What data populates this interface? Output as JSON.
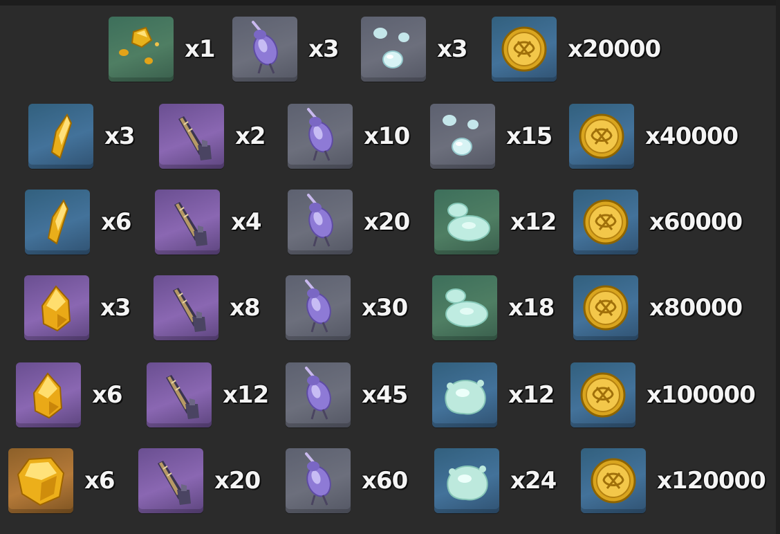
{
  "rows": [
    {
      "cells": [
        {
          "item": "gold-shards-icon",
          "rarity": "green",
          "qty": "x1"
        },
        {
          "item": "beetle-icon",
          "rarity": "gray",
          "qty": "x3"
        },
        {
          "item": "slime-drops-icon",
          "rarity": "gray",
          "qty": "x3"
        },
        {
          "item": "mora-coin-icon",
          "rarity": "blue",
          "qty": "x20000"
        }
      ]
    },
    {
      "cells": [
        {
          "item": "gold-sliver-icon",
          "rarity": "blue",
          "qty": "x3"
        },
        {
          "item": "drill-icon",
          "rarity": "purple",
          "qty": "x2"
        },
        {
          "item": "beetle-icon",
          "rarity": "gray",
          "qty": "x10"
        },
        {
          "item": "slime-drops-icon",
          "rarity": "gray",
          "qty": "x15"
        },
        {
          "item": "mora-coin-icon",
          "rarity": "blue",
          "qty": "x40000"
        }
      ]
    },
    {
      "cells": [
        {
          "item": "gold-sliver-icon",
          "rarity": "blue",
          "qty": "x6"
        },
        {
          "item": "drill-icon",
          "rarity": "purple",
          "qty": "x4"
        },
        {
          "item": "beetle-icon",
          "rarity": "gray",
          "qty": "x20"
        },
        {
          "item": "slime-puddle-icon",
          "rarity": "green",
          "qty": "x12"
        },
        {
          "item": "mora-coin-icon",
          "rarity": "blue",
          "qty": "x60000"
        }
      ]
    },
    {
      "cells": [
        {
          "item": "gold-chunk-icon",
          "rarity": "purple",
          "qty": "x3"
        },
        {
          "item": "drill-icon",
          "rarity": "purple",
          "qty": "x8"
        },
        {
          "item": "beetle-icon",
          "rarity": "gray",
          "qty": "x30"
        },
        {
          "item": "slime-puddle-icon",
          "rarity": "green",
          "qty": "x18"
        },
        {
          "item": "mora-coin-icon",
          "rarity": "blue",
          "qty": "x80000"
        }
      ]
    },
    {
      "cells": [
        {
          "item": "gold-chunk-icon",
          "rarity": "purple",
          "qty": "x6"
        },
        {
          "item": "drill-icon",
          "rarity": "purple",
          "qty": "x12"
        },
        {
          "item": "beetle-icon",
          "rarity": "gray",
          "qty": "x45"
        },
        {
          "item": "slime-blob-icon",
          "rarity": "blue",
          "qty": "x12"
        },
        {
          "item": "mora-coin-icon",
          "rarity": "blue",
          "qty": "x100000"
        }
      ]
    },
    {
      "cells": [
        {
          "item": "gold-gem-icon",
          "rarity": "gold",
          "qty": "x6"
        },
        {
          "item": "drill-icon",
          "rarity": "purple",
          "qty": "x20"
        },
        {
          "item": "beetle-icon",
          "rarity": "gray",
          "qty": "x60"
        },
        {
          "item": "slime-blob-icon",
          "rarity": "blue",
          "qty": "x24"
        },
        {
          "item": "mora-coin-icon",
          "rarity": "blue",
          "qty": "x120000"
        }
      ]
    }
  ],
  "colors": {
    "background": "#2b2b2b",
    "green": "#4f7e63",
    "gray": "#6c6f7c",
    "blue": "#43729a",
    "purple": "#8a67b2",
    "gold": "#b57a39"
  }
}
